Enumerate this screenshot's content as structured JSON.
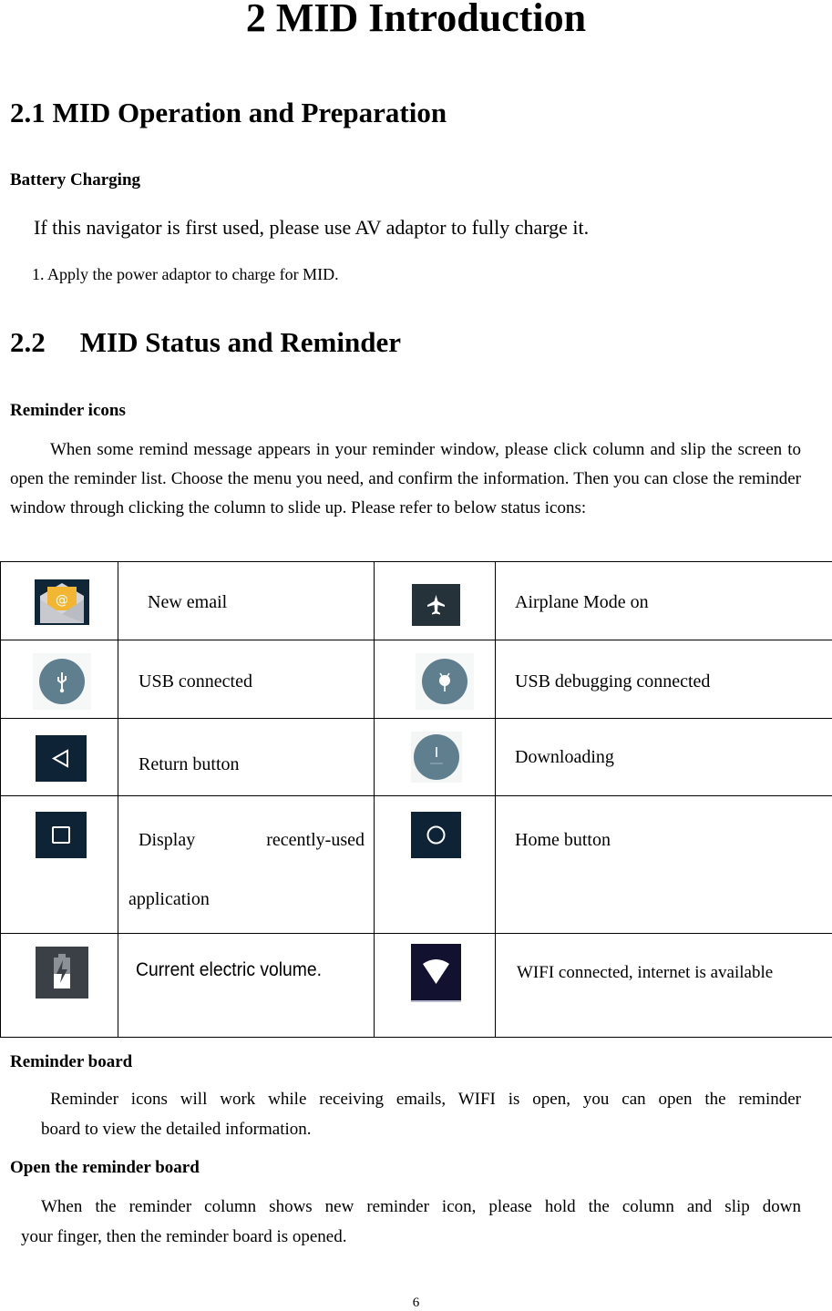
{
  "title": "2 MID Introduction",
  "section_2_1": {
    "heading": "2.1 MID Operation and Preparation",
    "subheading": "Battery Charging",
    "intro": "If this navigator is first used, please use AV adaptor to fully charge it.",
    "step_1": "1. Apply the power adaptor to charge for MID."
  },
  "section_2_2": {
    "number": "2.2",
    "heading": "MID Status and Reminder",
    "reminder_icons": {
      "subheading": "Reminder icons",
      "body": "When some remind message appears in your reminder window, please click column and slip the screen to open the reminder list. Choose the menu you need, and confirm the information. Then you can close the reminder window through clicking the column to slide up. Please refer to below status icons:"
    },
    "icon_table": [
      {
        "left": {
          "icon": "email-icon",
          "label": "New email"
        },
        "right": {
          "icon": "airplane-icon",
          "label": "Airplane Mode on"
        }
      },
      {
        "left": {
          "icon": "usb-icon",
          "label": "USB connected"
        },
        "right": {
          "icon": "android-debug-icon",
          "label": "USB debugging connected"
        }
      },
      {
        "left": {
          "icon": "back-arrow-icon",
          "label": "Return button"
        },
        "right": {
          "icon": "download-icon",
          "label": "Downloading"
        }
      },
      {
        "left": {
          "icon": "recent-apps-icon",
          "label_line1_a": "Display",
          "label_line1_b": "recently-used",
          "label_line2": "application"
        },
        "right": {
          "icon": "home-icon",
          "label": "Home button"
        }
      },
      {
        "left": {
          "icon": "battery-charging-icon",
          "label": "Current electric volume."
        },
        "right": {
          "icon": "wifi-icon",
          "label": "WIFI connected, internet is available"
        }
      }
    ],
    "reminder_board": {
      "subheading": "Reminder board",
      "body_line1": "Reminder icons will work while receiving emails, WIFI is open, you can open the reminder",
      "body_line2": "board to view the detailed information."
    },
    "open_board": {
      "subheading": "Open the reminder board",
      "body_line1": "When the reminder column shows new reminder icon, please hold the column and slip down",
      "body_line2": "your finger, then the reminder board is opened."
    }
  },
  "colors": {
    "icon_dark_navy": "#0f2336",
    "icon_slate_circle": "#5f7f8f",
    "icon_airplane_bg": "#26323a",
    "icon_email_yellow": "#f2b632",
    "icon_wifi_bg": "#121230",
    "icon_battery_bg": "#3a4046"
  },
  "page_number": "6"
}
